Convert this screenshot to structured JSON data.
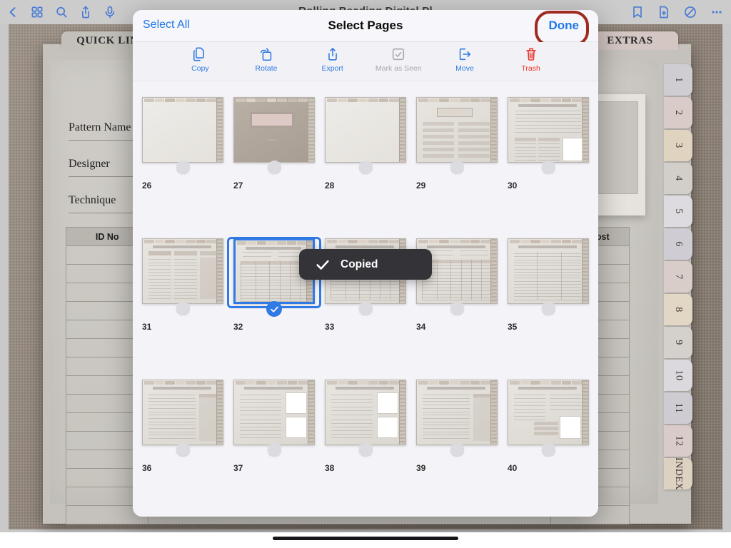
{
  "app": {
    "document_title": "Rolling Beading Digital Pl",
    "left_icons": [
      {
        "name": "back-icon",
        "label": "Back"
      },
      {
        "name": "grid-view-icon",
        "label": "Thumbnails"
      },
      {
        "name": "search-icon",
        "label": "Search"
      },
      {
        "name": "share-icon",
        "label": "Share"
      },
      {
        "name": "microphone-icon",
        "label": "Record"
      }
    ],
    "right_icons": [
      {
        "name": "bookmark-icon",
        "label": "Bookmark"
      },
      {
        "name": "add-page-icon",
        "label": "Add Page"
      },
      {
        "name": "no-ink-icon",
        "label": "Toggle Ink"
      },
      {
        "name": "more-options-icon",
        "label": "More"
      }
    ]
  },
  "background_document": {
    "top_tab_left": "QUICK LINKS",
    "top_tab_right": "EXTRAS",
    "fields": [
      {
        "label": "Pattern Name"
      },
      {
        "label": "Designer"
      },
      {
        "label": "Technique"
      }
    ],
    "table_headers": [
      "ID No",
      "Est. Cost"
    ],
    "side_tabs": [
      "1",
      "2",
      "3",
      "4",
      "5",
      "6",
      "7",
      "8",
      "9",
      "10",
      "11",
      "12",
      "INDEX"
    ]
  },
  "sheet": {
    "title": "Select Pages",
    "select_all_label": "Select All",
    "done_label": "Done",
    "done_highlight_color": "#9e2a20",
    "accent_color": "#2f7ae5",
    "toolbar": [
      {
        "label": "Copy",
        "icon": "copy-icon",
        "state": "enabled"
      },
      {
        "label": "Rotate",
        "icon": "rotate-icon",
        "state": "enabled"
      },
      {
        "label": "Export",
        "icon": "export-icon",
        "state": "enabled"
      },
      {
        "label": "Mark as Seen",
        "icon": "mark-as-seen-icon",
        "state": "disabled"
      },
      {
        "label": "Move",
        "icon": "move-icon",
        "state": "enabled"
      },
      {
        "label": "Trash",
        "icon": "trash-icon",
        "state": "destructive"
      }
    ],
    "toast": {
      "text": "Copied",
      "icon": "checkmark-icon"
    },
    "pages": [
      {
        "number": "26",
        "kind": "blank",
        "selected": false
      },
      {
        "number": "27",
        "kind": "cover",
        "selected": false
      },
      {
        "number": "28",
        "kind": "blank",
        "selected": false
      },
      {
        "number": "29",
        "kind": "index",
        "selected": false
      },
      {
        "number": "30",
        "kind": "form",
        "selected": false
      },
      {
        "number": "31",
        "kind": "columns",
        "selected": false
      },
      {
        "number": "32",
        "kind": "table",
        "selected": true
      },
      {
        "number": "33",
        "kind": "table",
        "selected": false
      },
      {
        "number": "34",
        "kind": "table",
        "selected": false
      },
      {
        "number": "35",
        "kind": "lines",
        "selected": false
      },
      {
        "number": "36",
        "kind": "notes",
        "selected": false
      },
      {
        "number": "37",
        "kind": "photos",
        "selected": false
      },
      {
        "number": "38",
        "kind": "photos",
        "selected": false
      },
      {
        "number": "39",
        "kind": "notes",
        "selected": false
      },
      {
        "number": "40",
        "kind": "record",
        "selected": false
      }
    ]
  }
}
